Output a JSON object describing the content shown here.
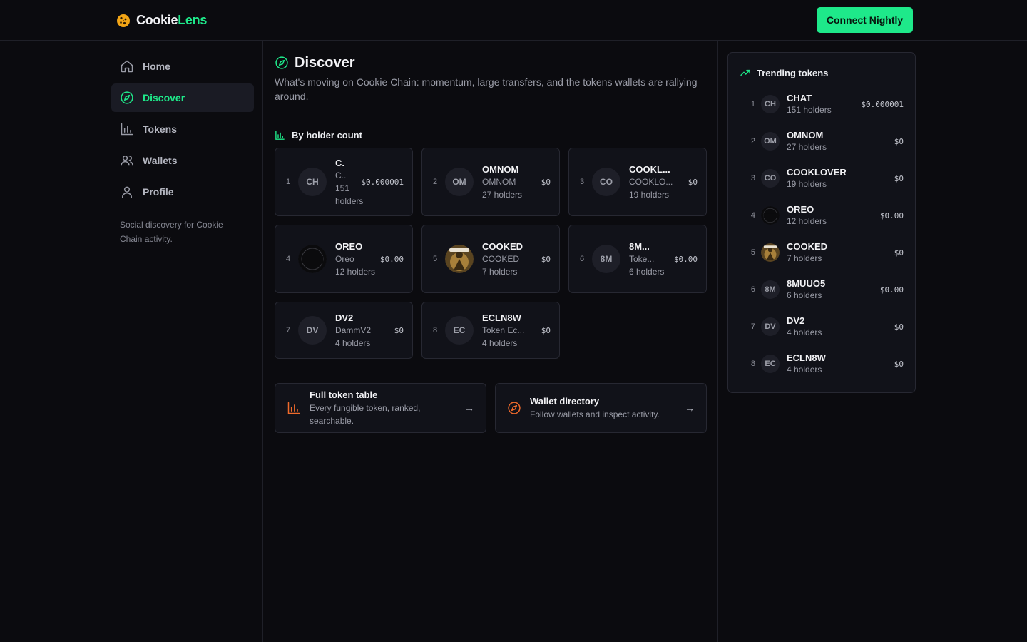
{
  "app": {
    "brand_part1": "Cookie",
    "brand_part2": "Lens",
    "logo_icon": "cookie-icon",
    "connect_label": "Connect Nightly",
    "accent": "#1ee98a",
    "secondary_accent": "#f06a2b"
  },
  "sidebar": {
    "items": [
      {
        "label": "Home",
        "icon": "home-icon",
        "active": false
      },
      {
        "label": "Discover",
        "icon": "compass-icon",
        "active": true
      },
      {
        "label": "Tokens",
        "icon": "bar-chart-icon",
        "active": false
      },
      {
        "label": "Wallets",
        "icon": "users-icon",
        "active": false
      },
      {
        "label": "Profile",
        "icon": "user-icon",
        "active": false
      }
    ],
    "note": "Social discovery for Cookie Chain activity."
  },
  "main": {
    "title": "Discover",
    "description": "What's moving on Cookie Chain: momentum, large transfers, and the tokens wallets are rallying around.",
    "section_title": "By holder count",
    "cards": [
      {
        "rank": "1",
        "avatar": "CH",
        "symbol": "C.",
        "name": "C..",
        "holders": "151 holders",
        "price": "$0.000001"
      },
      {
        "rank": "2",
        "avatar": "OM",
        "symbol": "OMNOM",
        "name": "OMNOM",
        "holders": "27 holders",
        "price": "$0"
      },
      {
        "rank": "3",
        "avatar": "CO",
        "symbol": "COOKL...",
        "name": "COOKLO...",
        "holders": "19 holders",
        "price": "$0"
      },
      {
        "rank": "4",
        "avatar": "oreo-logo",
        "symbol": "OREO",
        "name": "Oreo",
        "holders": "12 holders",
        "price": "$0.00"
      },
      {
        "rank": "5",
        "avatar": "cooked-logo",
        "symbol": "COOKED",
        "name": "COOKED",
        "holders": "7 holders",
        "price": "$0"
      },
      {
        "rank": "6",
        "avatar": "8M",
        "symbol": "8M...",
        "name": "Toke...",
        "holders": "6 holders",
        "price": "$0.00"
      },
      {
        "rank": "7",
        "avatar": "DV",
        "symbol": "DV2",
        "name": "DammV2",
        "holders": "4 holders",
        "price": "$0"
      },
      {
        "rank": "8",
        "avatar": "EC",
        "symbol": "ECLN8W",
        "name": "Token Ec...",
        "holders": "4 holders",
        "price": "$0"
      }
    ]
  },
  "links": [
    {
      "icon": "bar-chart-icon",
      "title": "Full token table",
      "desc": "Every fungible token, ranked, searchable.",
      "arrow": "→"
    },
    {
      "icon": "compass-icon",
      "title": "Wallet directory",
      "desc": "Follow wallets and inspect activity.",
      "arrow": "→"
    }
  ],
  "trending": {
    "title": "Trending tokens",
    "icon": "trending-up-icon",
    "rows": [
      {
        "rank": "1",
        "avatar": "CH",
        "symbol": "CHAT",
        "holders": "151 holders",
        "price": "$0.000001"
      },
      {
        "rank": "2",
        "avatar": "OM",
        "symbol": "OMNOM",
        "holders": "27 holders",
        "price": "$0"
      },
      {
        "rank": "3",
        "avatar": "CO",
        "symbol": "COOKLOVER",
        "holders": "19 holders",
        "price": "$0"
      },
      {
        "rank": "4",
        "avatar": "oreo-logo",
        "symbol": "OREO",
        "holders": "12 holders",
        "price": "$0.00"
      },
      {
        "rank": "5",
        "avatar": "cooked-logo",
        "symbol": "COOKED",
        "holders": "7 holders",
        "price": "$0"
      },
      {
        "rank": "6",
        "avatar": "8M",
        "symbol": "8MUUO5",
        "holders": "6 holders",
        "price": "$0.00"
      },
      {
        "rank": "7",
        "avatar": "DV",
        "symbol": "DV2",
        "holders": "4 holders",
        "price": "$0"
      },
      {
        "rank": "8",
        "avatar": "EC",
        "symbol": "ECLN8W",
        "holders": "4 holders",
        "price": "$0"
      }
    ]
  }
}
